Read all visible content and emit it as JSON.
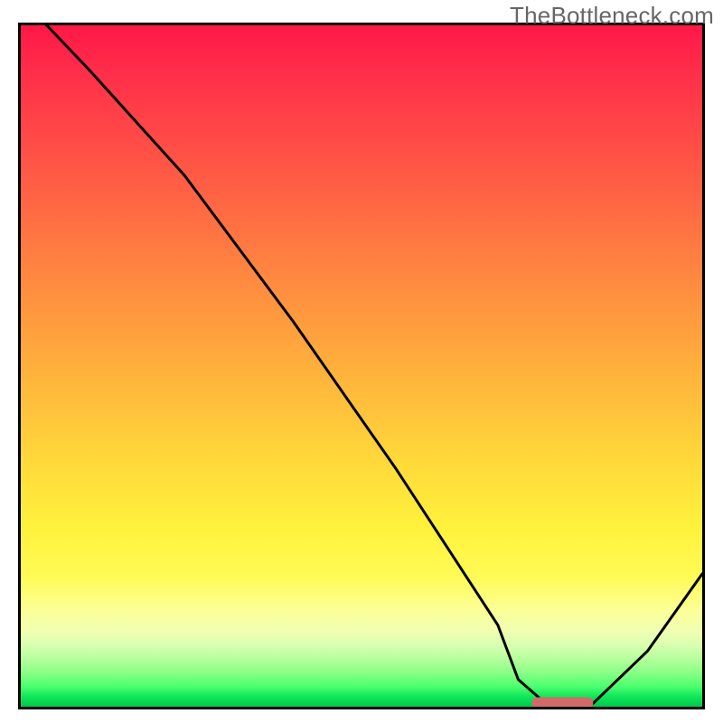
{
  "watermark": "TheBottleneck.com",
  "chart_data": {
    "type": "line",
    "title": "",
    "xlabel": "",
    "ylabel": "",
    "xlim": [
      0,
      100
    ],
    "ylim": [
      0,
      100
    ],
    "grid": false,
    "background": "rainbow-gradient-red-to-green",
    "series": [
      {
        "name": "bottleneck-curve",
        "x": [
          0,
          10,
          24,
          40,
          55,
          70,
          73,
          77,
          84,
          92,
          100
        ],
        "y": [
          104,
          93.5,
          78,
          56.5,
          35,
          12,
          4,
          0.5,
          0.5,
          8.2,
          19.5
        ]
      }
    ],
    "annotations": [
      {
        "type": "rounded-bar",
        "name": "optimal-range-marker",
        "x_start": 75,
        "x_end": 84,
        "y": 0.6,
        "color": "#d36a6a"
      }
    ]
  }
}
